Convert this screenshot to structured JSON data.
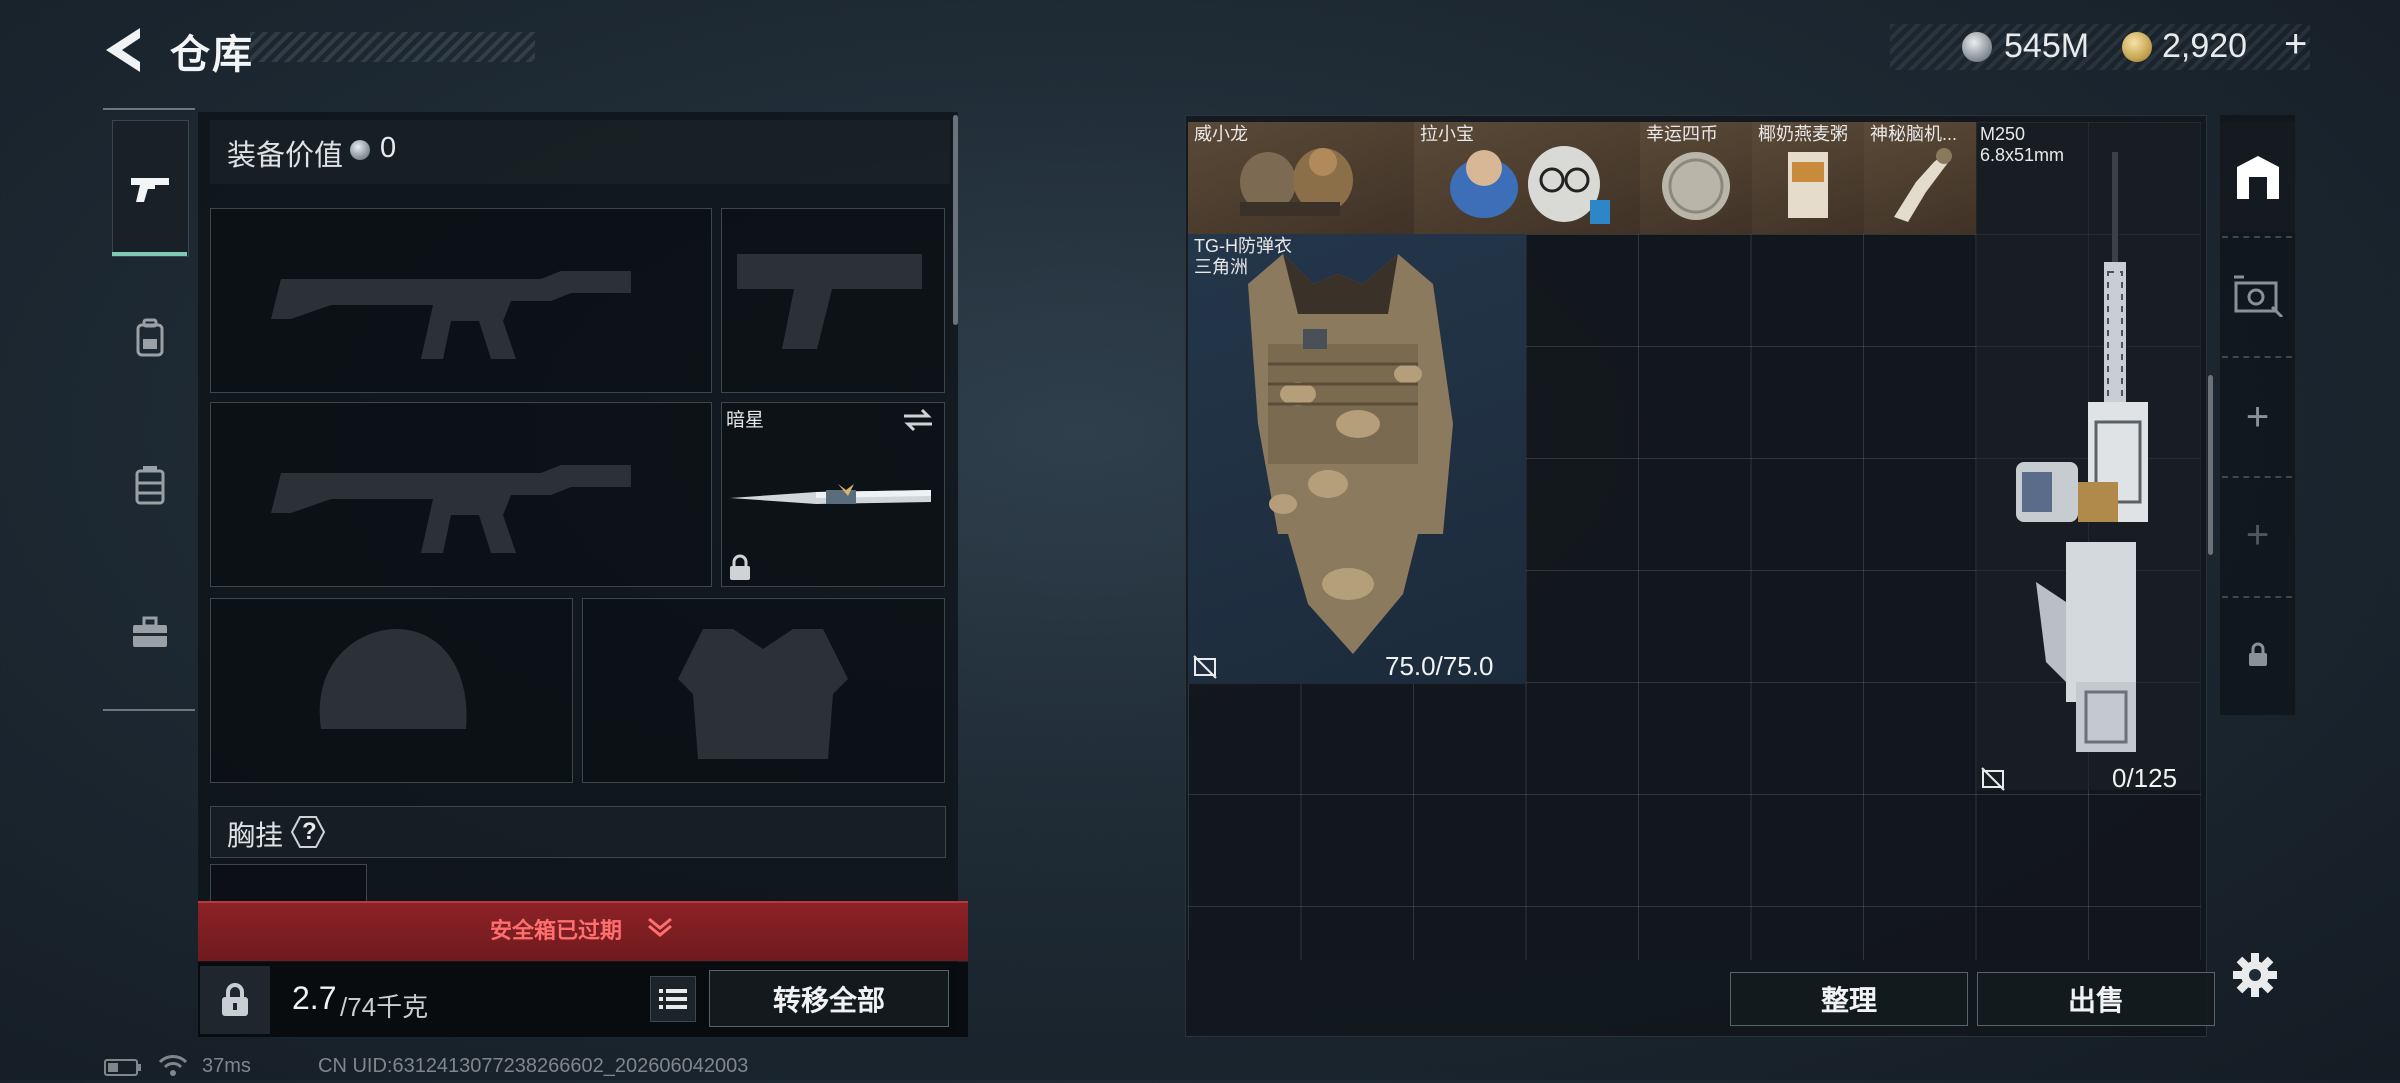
{
  "header": {
    "title": "仓库",
    "currencies": {
      "silver": "545M",
      "gold": "2,920",
      "add": "+"
    }
  },
  "loadout": {
    "equip_value_label": "装备价值",
    "equip_value": "0",
    "melee_name": "暗星",
    "chest_rig_label": "胸挂",
    "chest_rig_help": "?",
    "safebox_status": "安全箱已过期",
    "weight_current": "2.7",
    "weight_max": "/74千克",
    "transfer_all": "转移全部"
  },
  "stash": {
    "items": [
      {
        "name": "威小龙"
      },
      {
        "name": "拉小宝"
      },
      {
        "name": "幸运四币"
      },
      {
        "name": "椰奶燕麦粥"
      },
      {
        "name": "神秘脑机..."
      },
      {
        "name": "M250",
        "detail": "6.8x51mm",
        "ammo": "0/125"
      },
      {
        "name": "TG-H防弹衣",
        "detail": "三角洲",
        "durability": "75.0/75.0"
      }
    ],
    "sort": "整理",
    "sell": "出售",
    "add_symbol": "+"
  },
  "status": {
    "ping": "37ms",
    "uid": "CN UID:6312413077238266602_202606042003"
  },
  "colors": {
    "accent_tab": "#7fc9b5",
    "warning_red": "#8c2226",
    "warning_text": "#ff6f6f"
  }
}
